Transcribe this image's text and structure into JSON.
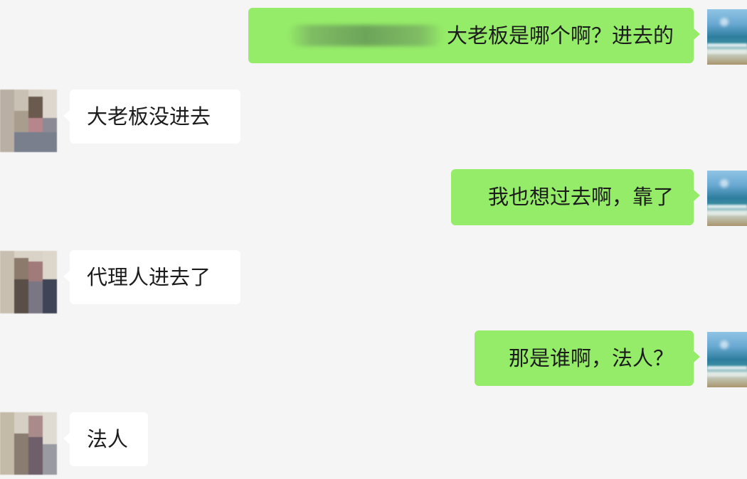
{
  "messages": [
    {
      "side": "sent",
      "text": "大老板是哪个啊？进去的",
      "prefix_redacted": true
    },
    {
      "side": "received",
      "text": "大老板没进去"
    },
    {
      "side": "sent",
      "text": "我也想过去啊，靠了"
    },
    {
      "side": "received",
      "text": "代理人进去了"
    },
    {
      "side": "sent",
      "text": "那是谁啊，法人？"
    },
    {
      "side": "received",
      "text": "法人"
    }
  ],
  "colors": {
    "background": "#f5f5f5",
    "sent_bubble": "#95ec69",
    "received_bubble": "#ffffff",
    "text": "#1c1c1c"
  },
  "icons": {
    "self_avatar": "ocean-photo-avatar",
    "other_avatar": "pixelated-person-avatar"
  }
}
